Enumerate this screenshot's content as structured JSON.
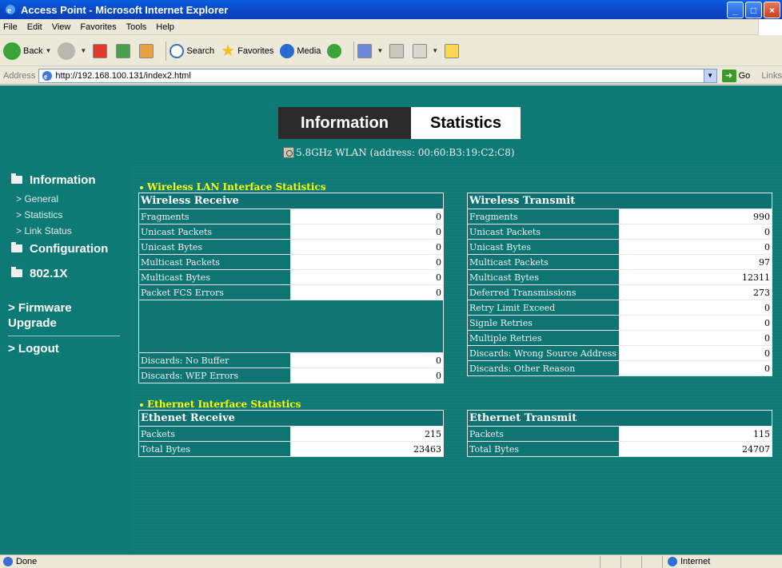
{
  "window": {
    "title": "Access Point - Microsoft Internet Explorer",
    "min_label": "_",
    "max_label": "□",
    "close_label": "×"
  },
  "menu": [
    "File",
    "Edit",
    "View",
    "Favorites",
    "Tools",
    "Help"
  ],
  "toolbar": {
    "back_label": "Back",
    "search_label": "Search",
    "favorites_label": "Favorites",
    "media_label": "Media"
  },
  "address": {
    "label": "Address",
    "url": "http://192.168.100.131/index2.html",
    "go_label": "Go",
    "links_label": "Links"
  },
  "header": {
    "tab_information": "Information",
    "tab_statistics": "Statistics",
    "wlan_text": "5.8GHz WLAN (address: 00:60:B3:19:C2:C8)"
  },
  "sidebar": {
    "information": "Information",
    "general": "> General",
    "statistics": "> Statistics",
    "link_status": "> Link Status",
    "configuration": "Configuration",
    "dot1x": "802.1X",
    "firmware": "> Firmware Upgrade",
    "logout": "> Logout"
  },
  "wireless": {
    "section_title": "Wireless LAN Interface Statistics",
    "receive": {
      "title": "Wireless Receive",
      "rows": [
        {
          "label": "Fragments",
          "value": "0"
        },
        {
          "label": "Unicast Packets",
          "value": "0"
        },
        {
          "label": "Unicast Bytes",
          "value": "0"
        },
        {
          "label": "Multicast Packets",
          "value": "0"
        },
        {
          "label": "Multicast Bytes",
          "value": "0"
        },
        {
          "label": "Packet FCS Errors",
          "value": "0"
        }
      ],
      "discards": [
        {
          "label": "Discards: No Buffer",
          "value": "0"
        },
        {
          "label": "Discards: WEP Errors",
          "value": "0"
        }
      ]
    },
    "transmit": {
      "title": "Wireless Transmit",
      "rows": [
        {
          "label": "Fragments",
          "value": "990"
        },
        {
          "label": "Unicast Packets",
          "value": "0"
        },
        {
          "label": "Unicast Bytes",
          "value": "0"
        },
        {
          "label": "Multicast Packets",
          "value": "97"
        },
        {
          "label": "Multicast Bytes",
          "value": "12311"
        },
        {
          "label": "Deferred Transmissions",
          "value": "273"
        },
        {
          "label": "Retry Limit Exceed",
          "value": "0"
        },
        {
          "label": "Signle Retries",
          "value": "0"
        },
        {
          "label": "Multiple Retries",
          "value": "0"
        },
        {
          "label": "Discards: Wrong Source Address",
          "value": "0"
        },
        {
          "label": "Discards: Other Reason",
          "value": "0"
        }
      ]
    }
  },
  "ethernet": {
    "section_title": "Ethernet Interface Statistics",
    "receive": {
      "title": "Ethenet Receive",
      "rows": [
        {
          "label": "Packets",
          "value": "215"
        },
        {
          "label": "Total Bytes",
          "value": "23463"
        }
      ]
    },
    "transmit": {
      "title": "Ethernet Transmit",
      "rows": [
        {
          "label": "Packets",
          "value": "115"
        },
        {
          "label": "Total Bytes",
          "value": "24707"
        }
      ]
    }
  },
  "status": {
    "text": "Done",
    "zone": "Internet"
  }
}
